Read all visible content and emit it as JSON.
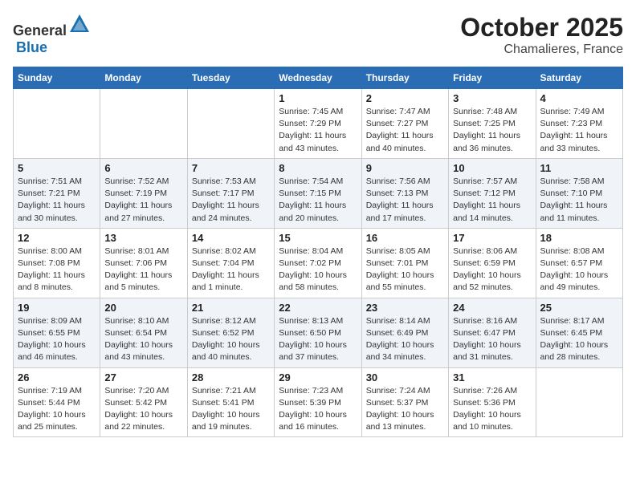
{
  "header": {
    "logo_general": "General",
    "logo_blue": "Blue",
    "month": "October 2025",
    "location": "Chamalieres, France"
  },
  "weekdays": [
    "Sunday",
    "Monday",
    "Tuesday",
    "Wednesday",
    "Thursday",
    "Friday",
    "Saturday"
  ],
  "weeks": [
    [
      {
        "day": "",
        "info": ""
      },
      {
        "day": "",
        "info": ""
      },
      {
        "day": "",
        "info": ""
      },
      {
        "day": "1",
        "info": "Sunrise: 7:45 AM\nSunset: 7:29 PM\nDaylight: 11 hours\nand 43 minutes."
      },
      {
        "day": "2",
        "info": "Sunrise: 7:47 AM\nSunset: 7:27 PM\nDaylight: 11 hours\nand 40 minutes."
      },
      {
        "day": "3",
        "info": "Sunrise: 7:48 AM\nSunset: 7:25 PM\nDaylight: 11 hours\nand 36 minutes."
      },
      {
        "day": "4",
        "info": "Sunrise: 7:49 AM\nSunset: 7:23 PM\nDaylight: 11 hours\nand 33 minutes."
      }
    ],
    [
      {
        "day": "5",
        "info": "Sunrise: 7:51 AM\nSunset: 7:21 PM\nDaylight: 11 hours\nand 30 minutes."
      },
      {
        "day": "6",
        "info": "Sunrise: 7:52 AM\nSunset: 7:19 PM\nDaylight: 11 hours\nand 27 minutes."
      },
      {
        "day": "7",
        "info": "Sunrise: 7:53 AM\nSunset: 7:17 PM\nDaylight: 11 hours\nand 24 minutes."
      },
      {
        "day": "8",
        "info": "Sunrise: 7:54 AM\nSunset: 7:15 PM\nDaylight: 11 hours\nand 20 minutes."
      },
      {
        "day": "9",
        "info": "Sunrise: 7:56 AM\nSunset: 7:13 PM\nDaylight: 11 hours\nand 17 minutes."
      },
      {
        "day": "10",
        "info": "Sunrise: 7:57 AM\nSunset: 7:12 PM\nDaylight: 11 hours\nand 14 minutes."
      },
      {
        "day": "11",
        "info": "Sunrise: 7:58 AM\nSunset: 7:10 PM\nDaylight: 11 hours\nand 11 minutes."
      }
    ],
    [
      {
        "day": "12",
        "info": "Sunrise: 8:00 AM\nSunset: 7:08 PM\nDaylight: 11 hours\nand 8 minutes."
      },
      {
        "day": "13",
        "info": "Sunrise: 8:01 AM\nSunset: 7:06 PM\nDaylight: 11 hours\nand 5 minutes."
      },
      {
        "day": "14",
        "info": "Sunrise: 8:02 AM\nSunset: 7:04 PM\nDaylight: 11 hours\nand 1 minute."
      },
      {
        "day": "15",
        "info": "Sunrise: 8:04 AM\nSunset: 7:02 PM\nDaylight: 10 hours\nand 58 minutes."
      },
      {
        "day": "16",
        "info": "Sunrise: 8:05 AM\nSunset: 7:01 PM\nDaylight: 10 hours\nand 55 minutes."
      },
      {
        "day": "17",
        "info": "Sunrise: 8:06 AM\nSunset: 6:59 PM\nDaylight: 10 hours\nand 52 minutes."
      },
      {
        "day": "18",
        "info": "Sunrise: 8:08 AM\nSunset: 6:57 PM\nDaylight: 10 hours\nand 49 minutes."
      }
    ],
    [
      {
        "day": "19",
        "info": "Sunrise: 8:09 AM\nSunset: 6:55 PM\nDaylight: 10 hours\nand 46 minutes."
      },
      {
        "day": "20",
        "info": "Sunrise: 8:10 AM\nSunset: 6:54 PM\nDaylight: 10 hours\nand 43 minutes."
      },
      {
        "day": "21",
        "info": "Sunrise: 8:12 AM\nSunset: 6:52 PM\nDaylight: 10 hours\nand 40 minutes."
      },
      {
        "day": "22",
        "info": "Sunrise: 8:13 AM\nSunset: 6:50 PM\nDaylight: 10 hours\nand 37 minutes."
      },
      {
        "day": "23",
        "info": "Sunrise: 8:14 AM\nSunset: 6:49 PM\nDaylight: 10 hours\nand 34 minutes."
      },
      {
        "day": "24",
        "info": "Sunrise: 8:16 AM\nSunset: 6:47 PM\nDaylight: 10 hours\nand 31 minutes."
      },
      {
        "day": "25",
        "info": "Sunrise: 8:17 AM\nSunset: 6:45 PM\nDaylight: 10 hours\nand 28 minutes."
      }
    ],
    [
      {
        "day": "26",
        "info": "Sunrise: 7:19 AM\nSunset: 5:44 PM\nDaylight: 10 hours\nand 25 minutes."
      },
      {
        "day": "27",
        "info": "Sunrise: 7:20 AM\nSunset: 5:42 PM\nDaylight: 10 hours\nand 22 minutes."
      },
      {
        "day": "28",
        "info": "Sunrise: 7:21 AM\nSunset: 5:41 PM\nDaylight: 10 hours\nand 19 minutes."
      },
      {
        "day": "29",
        "info": "Sunrise: 7:23 AM\nSunset: 5:39 PM\nDaylight: 10 hours\nand 16 minutes."
      },
      {
        "day": "30",
        "info": "Sunrise: 7:24 AM\nSunset: 5:37 PM\nDaylight: 10 hours\nand 13 minutes."
      },
      {
        "day": "31",
        "info": "Sunrise: 7:26 AM\nSunset: 5:36 PM\nDaylight: 10 hours\nand 10 minutes."
      },
      {
        "day": "",
        "info": ""
      }
    ]
  ]
}
